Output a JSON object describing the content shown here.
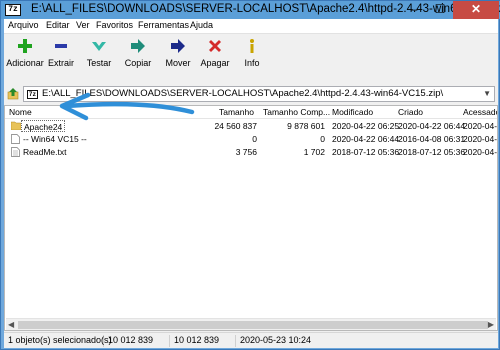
{
  "window": {
    "title": "E:\\ALL_FILES\\DOWNLOADS\\SERVER-LOCALHOST\\Apache2.4\\httpd-2.4.43-win64-VC15.zip\\",
    "app_icon_text": "7z",
    "controls": {
      "minimize": "–",
      "maximize": "☐",
      "close": "✕"
    }
  },
  "menu": [
    "Arquivo",
    "Editar",
    "Ver",
    "Favoritos",
    "Ferramentas",
    "Ajuda"
  ],
  "toolbar": {
    "add": "Adicionar",
    "extract": "Extrair",
    "test": "Testar",
    "copy": "Copiar",
    "move": "Mover",
    "delete": "Apagar",
    "info": "Info"
  },
  "address": {
    "icon_text": "7z",
    "path": "E:\\ALL_FILES\\DOWNLOADS\\SERVER-LOCALHOST\\Apache2.4\\httpd-2.4.43-win64-VC15.zip\\"
  },
  "columns": [
    "Nome",
    "Tamanho",
    "Tamanho Comp...",
    "Modificado",
    "Criado",
    "Acessado"
  ],
  "rows": [
    {
      "name": "Apache24",
      "type": "folder",
      "size": "24 560 837",
      "packed": "9 878 601",
      "modified": "2020-04-22 06:25",
      "created": "2020-04-22 06:44",
      "accessed": "2020-04-2"
    },
    {
      "name": "-- Win64 VC15  --",
      "type": "file",
      "size": "0",
      "packed": "0",
      "modified": "2020-04-22 06:44",
      "created": "2016-04-08 06:31",
      "accessed": "2020-04-2"
    },
    {
      "name": "ReadMe.txt",
      "type": "file",
      "size": "3 756",
      "packed": "1 702",
      "modified": "2018-07-12 05:36",
      "created": "2018-07-12 05:36",
      "accessed": "2020-04-2"
    }
  ],
  "status": {
    "selection": "1 objeto(s) selecionado(s)",
    "size": "10 012 839",
    "packed": "10 012 839",
    "date": "2020-05-23 10:24"
  },
  "colors": {
    "titlebar": "#5b9fd8",
    "close": "#c74b44",
    "annotation_arrow": "#2f8fd8"
  }
}
